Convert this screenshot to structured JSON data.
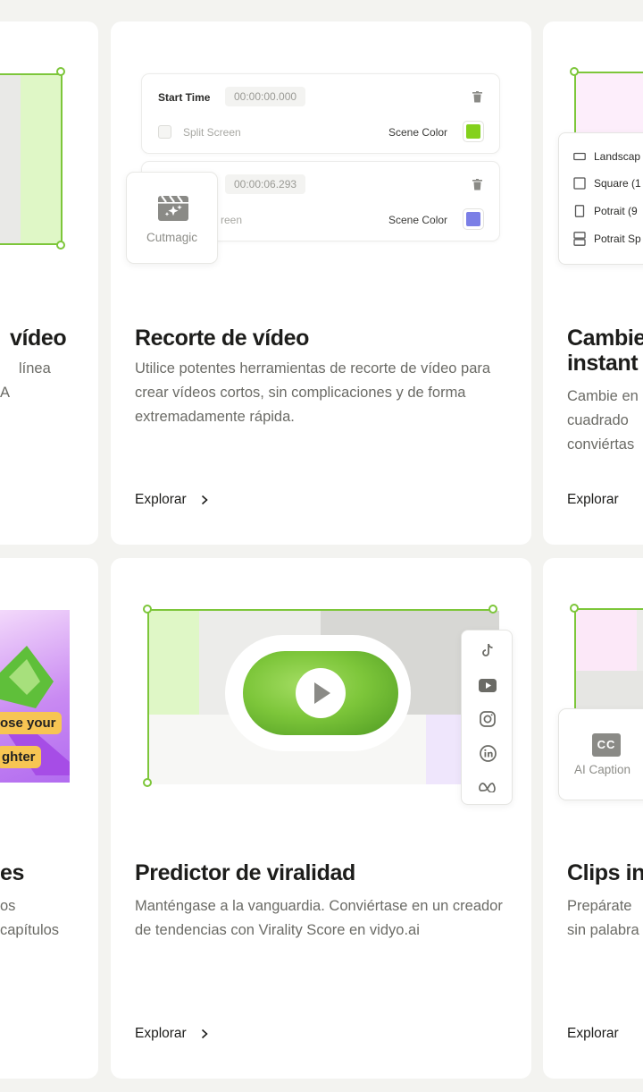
{
  "cards": {
    "left_top": {
      "title": "vídeo",
      "desc_lines": [
        "línea",
        "A"
      ]
    },
    "mid_top": {
      "title": "Recorte de vídeo",
      "desc": "Utilice potentes herramientas de recorte de vídeo para crear vídeos cortos, sin complicaciones y de forma extremadamente rápida.",
      "explore": "Explorar",
      "mock": {
        "start_time_label": "Start Time",
        "start_time_value": "00:00:00.000",
        "split_screen_label": "Split Screen",
        "scene_color_label": "Scene Color",
        "second_time_value": "00:00:06.293",
        "split_screen_partial": "reen",
        "color_1": "#84d11c",
        "color_2": "#7b7fe6",
        "cutmagic_label": "Cutmagic"
      }
    },
    "right_top": {
      "title_lines": [
        "Cambie",
        "instant"
      ],
      "desc_lines": [
        "Cambie en",
        "cuadrado",
        "conviértas"
      ],
      "explore": "Explorar",
      "menu": [
        "Landscap",
        "Square (1",
        "Potrait (9",
        "Potrait Sp"
      ]
    },
    "left_bottom": {
      "title": "es",
      "desc_lines": [
        "os",
        "capítulos"
      ],
      "badge_1": "ose your",
      "badge_2": "ghter"
    },
    "mid_bottom": {
      "title": "Predictor de viralidad",
      "desc": "Manténgase a la vanguardia. Conviértase en un creador de tendencias con Virality Score en vidyo.ai",
      "explore": "Explorar"
    },
    "right_bottom": {
      "title": "Clips in",
      "desc_lines": [
        "Prepárate",
        "sin palabra"
      ],
      "explore": "Explorar",
      "caption_label": "AI Caption",
      "cc_label": "CC"
    }
  },
  "colors": {
    "accent_green": "#7dc63a",
    "frame_green": "#dff7c6",
    "purple": "#b26cf0"
  }
}
